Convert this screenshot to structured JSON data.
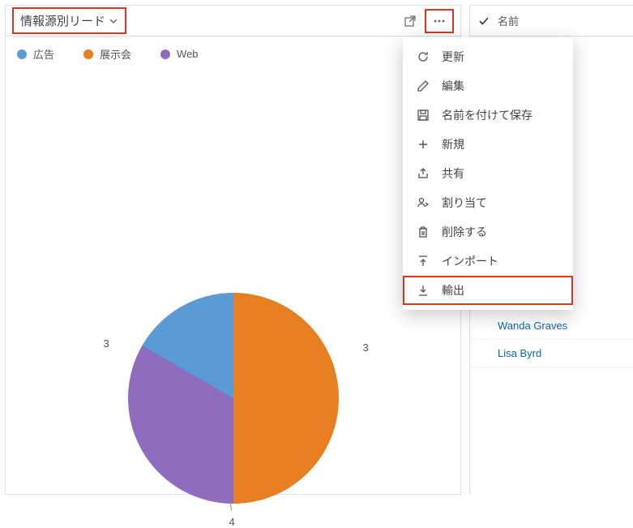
{
  "chart": {
    "title": "情報源別リード",
    "legend": [
      {
        "label": "広告",
        "color": "#5b9bd5"
      },
      {
        "label": "展示会",
        "color": "#e67e22"
      },
      {
        "label": "Web",
        "color": "#8e6dbf"
      }
    ]
  },
  "chart_data": {
    "type": "pie",
    "title": "情報源別リード",
    "categories": [
      "広告",
      "展示会",
      "Web"
    ],
    "values": [
      3,
      4,
      3
    ],
    "colors": [
      "#5b9bd5",
      "#e67e22",
      "#8e6dbf"
    ]
  },
  "slice_labels": {
    "blue": "3",
    "orange": "4",
    "purple": "3"
  },
  "list": {
    "header_label": "名前",
    "rows": [
      "Wanda Graves",
      "Lisa Byrd"
    ]
  },
  "menu": {
    "items": [
      {
        "id": "refresh",
        "label": "更新"
      },
      {
        "id": "edit",
        "label": "編集"
      },
      {
        "id": "saveas",
        "label": "名前を付けて保存"
      },
      {
        "id": "new",
        "label": "新規"
      },
      {
        "id": "share",
        "label": "共有"
      },
      {
        "id": "assign",
        "label": "割り当て"
      },
      {
        "id": "delete",
        "label": "削除する"
      },
      {
        "id": "import",
        "label": "インポート"
      },
      {
        "id": "export",
        "label": "輸出"
      }
    ]
  }
}
